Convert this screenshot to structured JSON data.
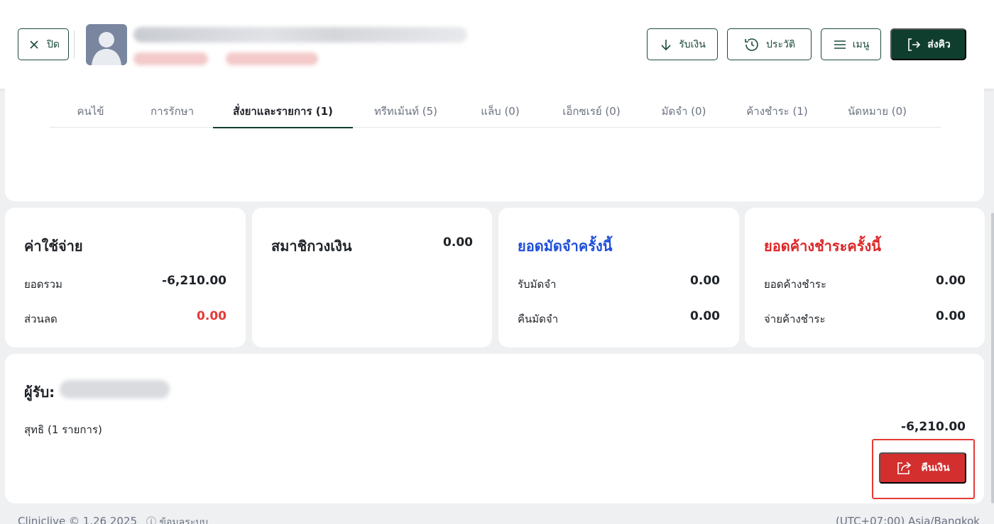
{
  "header": {
    "close_label": "ปิด",
    "receive_label": "รับเงิน",
    "history_label": "ประวัติ",
    "menu_label": "เมนู",
    "queue_label": "ส่งคิว"
  },
  "tabs": [
    {
      "label": "คนไข้"
    },
    {
      "label": "การรักษา"
    },
    {
      "label": "สั่งยาและรายการ (1)"
    },
    {
      "label": "ทรีทเม้นท์ (5)"
    },
    {
      "label": "แล็บ (0)"
    },
    {
      "label": "เอ็กซเรย์ (0)"
    },
    {
      "label": "มัดจำ (0)"
    },
    {
      "label": "ค้างชำระ (1)"
    },
    {
      "label": "นัดหมาย (0)"
    }
  ],
  "expense": {
    "title": "ค่าใช้จ่าย",
    "total_label": "ยอดรวม",
    "total_value": "-6,210.00",
    "discount_label": "ส่วนลด",
    "discount_value": "0.00"
  },
  "member_wallet": {
    "title": "สมาชิกวงเงิน",
    "value": "0.00"
  },
  "deposit": {
    "title": "ยอดมัดจำครั้งนี้",
    "receive_label": "รับมัดจำ",
    "receive_value": "0.00",
    "refund_label": "คืนมัดจำ",
    "refund_value": "0.00"
  },
  "outstanding": {
    "title": "ยอดค้างชำระครั้งนี้",
    "balance_label": "ยอดค้างชำระ",
    "balance_value": "0.00",
    "pay_label": "จ่ายค้างชำระ",
    "pay_value": "0.00"
  },
  "recipient": {
    "label": "ผู้รับ:",
    "net_label": "สุทธิ (1 รายการ)",
    "net_value": "-6,210.00",
    "refund_button_label": "คืนเงิน"
  },
  "footer": {
    "left_text": "Cliniclive © 1.26 2025",
    "info_text": "ⓘ ข้อมูลระบบ",
    "timezone": "(UTC+07:00) Asia/Bangkok"
  },
  "colors": {
    "primary": "#0f3d2e",
    "danger": "#d32f2f",
    "blue_title": "#1d4ed8",
    "red_title": "#dc2626"
  }
}
